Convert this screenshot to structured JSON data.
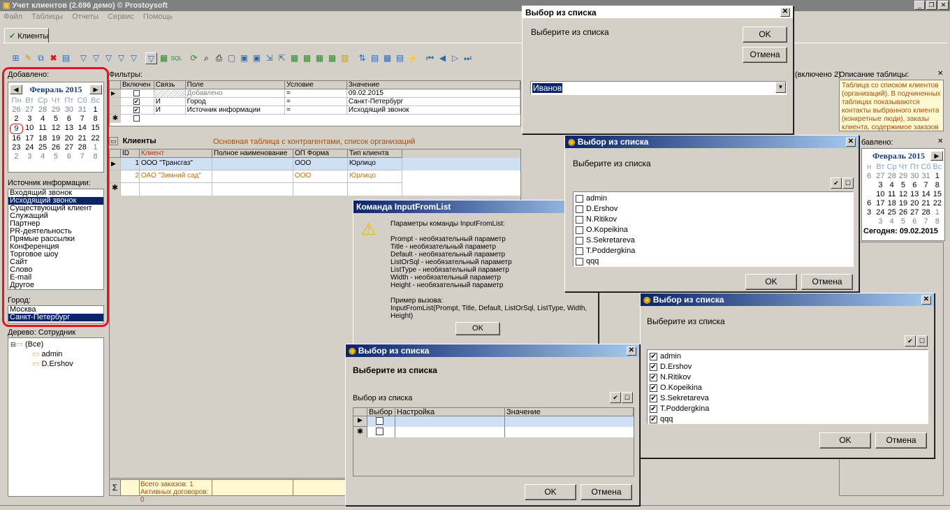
{
  "app": {
    "title": "Учет клиентов (2.696 демо) © Prostoysoft",
    "menu": [
      "Файл",
      "Таблицы",
      "Отчеты",
      "Сервис",
      "Помощь"
    ],
    "tab_label": "Клиенты"
  },
  "left": {
    "added_label": "Добавлено:",
    "calendar": {
      "month": "Февраль 2015",
      "day_names": [
        "Пн",
        "Вт",
        "Ср",
        "Чт",
        "Пт",
        "Сб",
        "Вс"
      ],
      "weeks": [
        [
          "26",
          "27",
          "28",
          "29",
          "30",
          "31",
          "1"
        ],
        [
          "2",
          "3",
          "4",
          "5",
          "6",
          "7",
          "8"
        ],
        [
          "9",
          "10",
          "11",
          "12",
          "13",
          "14",
          "15"
        ],
        [
          "16",
          "17",
          "18",
          "19",
          "20",
          "21",
          "22"
        ],
        [
          "23",
          "24",
          "25",
          "26",
          "27",
          "28",
          "1"
        ],
        [
          "2",
          "3",
          "4",
          "5",
          "6",
          "7",
          "8"
        ]
      ]
    },
    "source_label": "Источник информации:",
    "sources": [
      "Входящий звонок",
      "Исходящий звонок",
      "Существующий клиент",
      "Служащий",
      "Партнер",
      "PR-деятельность",
      "Прямые рассылки",
      "Конференция",
      "Торговое шоу",
      "Сайт",
      "Слово",
      "E-mail",
      "Другое"
    ],
    "city_label": "Город:",
    "cities": [
      "Москва",
      "Санкт-Петербург"
    ],
    "tree_label": "Дерево: Сотрудник",
    "tree": [
      "(Все)",
      "admin",
      "D.Ershov"
    ]
  },
  "filters": {
    "label": "Фильтры:",
    "headers": [
      "Включен",
      "Связь",
      "Поле",
      "Условие",
      "Значение"
    ],
    "rows": [
      {
        "link": "",
        "field": "Добавлено",
        "cond": "=",
        "value": "09.02.2015"
      },
      {
        "link": "И",
        "field": "Город",
        "cond": "=",
        "value": "Санкт-Петербург"
      },
      {
        "link": "И",
        "field": "Источник информации",
        "cond": "=",
        "value": "Исходящий звонок"
      }
    ]
  },
  "clients": {
    "title": "Клиенты",
    "subtitle": "Основная таблица с контрагентами, список организаций",
    "headers": [
      "ID",
      "Клиент",
      "Полное наименование",
      "ОП Форма",
      "Тип клиента"
    ],
    "rows": [
      {
        "id": "1",
        "client": "ООО \"Трансгаз\"",
        "full": "",
        "form": "ООО",
        "type": "Юрлицо"
      },
      {
        "id": "2",
        "client": "ОАО \"Зимний сад\"",
        "full": "",
        "form": "ООО",
        "type": "Юрлицо"
      }
    ],
    "footer1": "Всего заказов: 1",
    "footer2": "Активных договоров: 0",
    "sigma": "Σ"
  },
  "right_panel": {
    "included": "(включено 2)",
    "desc_label": "Описание таблицы:",
    "desc_text": "Таблица со списком клиентов (организаций). В подчиненных таблицах показываются контакты выбранного клиента (конкретные люди), заказы клиента, содержимое заказов",
    "added_label": "бавлено:",
    "cal_month": "Февраль 2015",
    "day_names": [
      "н",
      "Вт",
      "Ср",
      "Чт",
      "Пт",
      "Сб",
      "Вс"
    ],
    "weeks": [
      [
        "6",
        "27",
        "28",
        "29",
        "30",
        "31",
        "1"
      ],
      [
        "",
        "3",
        "4",
        "5",
        "6",
        "7",
        "8"
      ],
      [
        "",
        "10",
        "11",
        "12",
        "13",
        "14",
        "15"
      ],
      [
        "6",
        "17",
        "18",
        "19",
        "20",
        "21",
        "22"
      ],
      [
        "3",
        "24",
        "25",
        "26",
        "27",
        "28",
        "1"
      ],
      [
        "",
        "3",
        "4",
        "5",
        "6",
        "7",
        "8"
      ]
    ],
    "today": "Сегодня: 09.02.2015"
  },
  "dlg1": {
    "title": "Выбор из списка",
    "prompt": "Выберите из списка",
    "value": "Иванов",
    "ok": "OK",
    "cancel": "Отмена"
  },
  "dlg2": {
    "title": "Выбор из списка",
    "prompt": "Выберите из списка",
    "items": [
      "admin",
      "D.Ershov",
      "N.Ritikov",
      "O.Kopeikina",
      "S.Sekretareva",
      "T.Poddergkina",
      "qqq"
    ],
    "ok": "OK",
    "cancel": "Отмена"
  },
  "dlg3": {
    "title": "Выбор из списка",
    "prompt": "Выберите из списка",
    "items": [
      "admin",
      "D.Ershov",
      "N.Ritikov",
      "O.Kopeikina",
      "S.Sekretareva",
      "T.Poddergkina",
      "qqq"
    ],
    "ok": "OK",
    "cancel": "Отмена"
  },
  "cmd": {
    "title": "Команда InputFromList",
    "lines": [
      "Параметры команды InputFromList:",
      "",
      "Prompt - необязательный параметр",
      "Title - необязательный параметр",
      "Default - необязательный параметр",
      "ListOrSql - необязательный параметр",
      "ListType - необязательный параметр",
      "Width - необязательный параметр",
      "Height - необязательный параметр",
      "",
      "Пример вызова:",
      "InputFromList(Prompt, Title, Default, ListOrSql, ListType, Width, Height)"
    ],
    "ok": "OK"
  },
  "dlg4": {
    "title": "Выбор из списка",
    "heading": "Выберите из списка",
    "sublabel": "Выбор из списка",
    "headers": [
      "Выбор",
      "Настройка",
      "Значение"
    ],
    "ok": "OK",
    "cancel": "Отмена"
  }
}
